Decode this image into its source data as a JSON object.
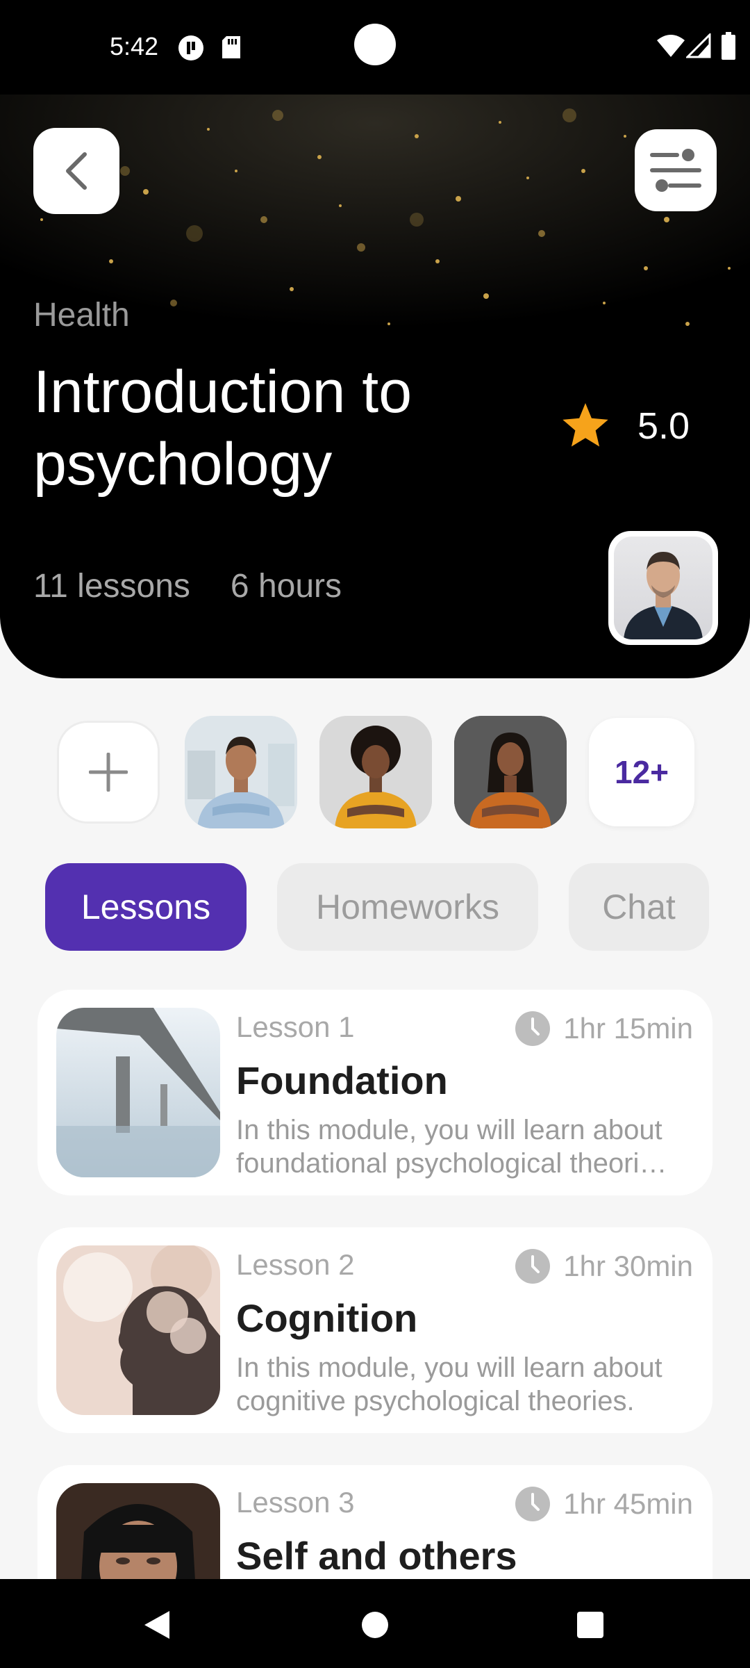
{
  "status_bar": {
    "time": "5:42"
  },
  "header": {
    "back_icon": "chevron-left-icon",
    "filter_icon": "sliders-icon",
    "category": "Health",
    "title": "Introduction to psychology",
    "rating": "5.0",
    "lessons_count": "11 lessons",
    "duration": "6 hours",
    "accent_star": "#f6a31b"
  },
  "participants": {
    "more_label": "12+"
  },
  "tabs": [
    {
      "label": "Lessons",
      "active": true
    },
    {
      "label": "Homeworks",
      "active": false
    },
    {
      "label": "Chat",
      "active": false
    }
  ],
  "lessons": [
    {
      "number": "Lesson 1",
      "time": "1hr 15min",
      "title": "Foundation",
      "desc1": "In this module, you will learn about",
      "desc2": "foundational psychological theori…"
    },
    {
      "number": "Lesson 2",
      "time": "1hr 30min",
      "title": "Cognition",
      "desc1": "In this module, you will learn about",
      "desc2": "cognitive psychological theories."
    },
    {
      "number": "Lesson 3",
      "time": "1hr 45min",
      "title": "Self and others",
      "desc1": "",
      "desc2": ""
    }
  ],
  "colors": {
    "accent": "#5330b0",
    "badge_text": "#4a2aa0"
  }
}
